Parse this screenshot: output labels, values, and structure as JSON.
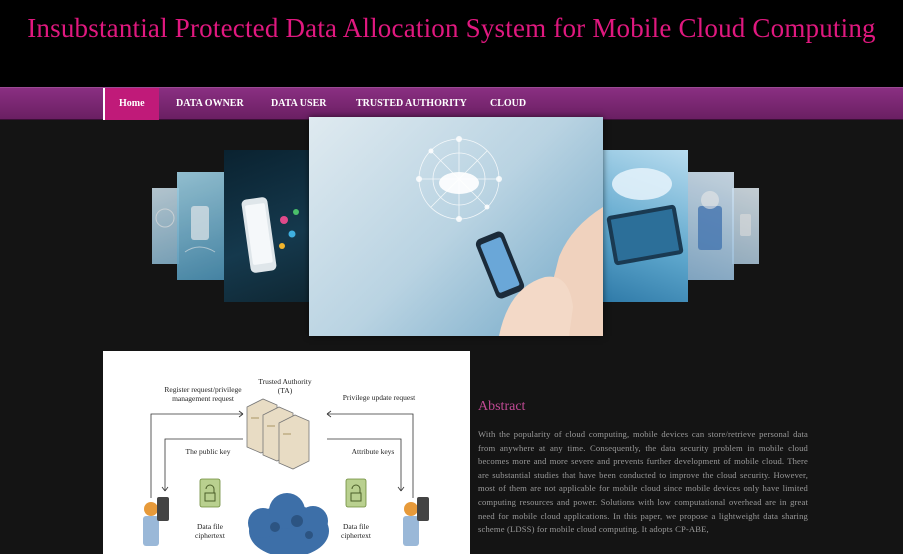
{
  "header": {
    "title": "Insubstantial Protected Data Allocation System for Mobile Cloud Computing"
  },
  "nav": {
    "items": [
      {
        "label": "Home",
        "active": true
      },
      {
        "label": "DATA OWNER"
      },
      {
        "label": "DATA USER"
      },
      {
        "label": "TRUSTED AUTHORITY"
      },
      {
        "label": "CLOUD"
      }
    ]
  },
  "figure": {
    "labels": {
      "register": "Register request/privilege management request",
      "ta": "Trusted Authority (TA)",
      "privilege_update": "Privilege update request",
      "public_key": "The public key",
      "attribute_keys": "Attribute keys",
      "ciphertext_left": "Data file ciphertext",
      "ciphertext_right": "Data file ciphertext"
    }
  },
  "abstract": {
    "title": "Abstract",
    "text": "With the popularity of cloud computing, mobile devices can store/retrieve personal data from anywhere at any time. Consequently, the data security problem in mobile cloud becomes more and more severe and prevents further development of mobile cloud. There are substantial studies that have been conducted to improve the cloud security. However, most of them are not applicable for mobile cloud since mobile devices only have limited computing resources and power. Solutions with low computational overhead are in great need for mobile cloud applications. In this paper, we propose a lightweight data sharing scheme (LDSS) for mobile cloud computing. It adopts CP-ABE,"
  },
  "colors": {
    "title": "#e0187f",
    "nav": "#7a2772",
    "nav_active": "#c01a79",
    "abstract_title": "#c04a94"
  }
}
